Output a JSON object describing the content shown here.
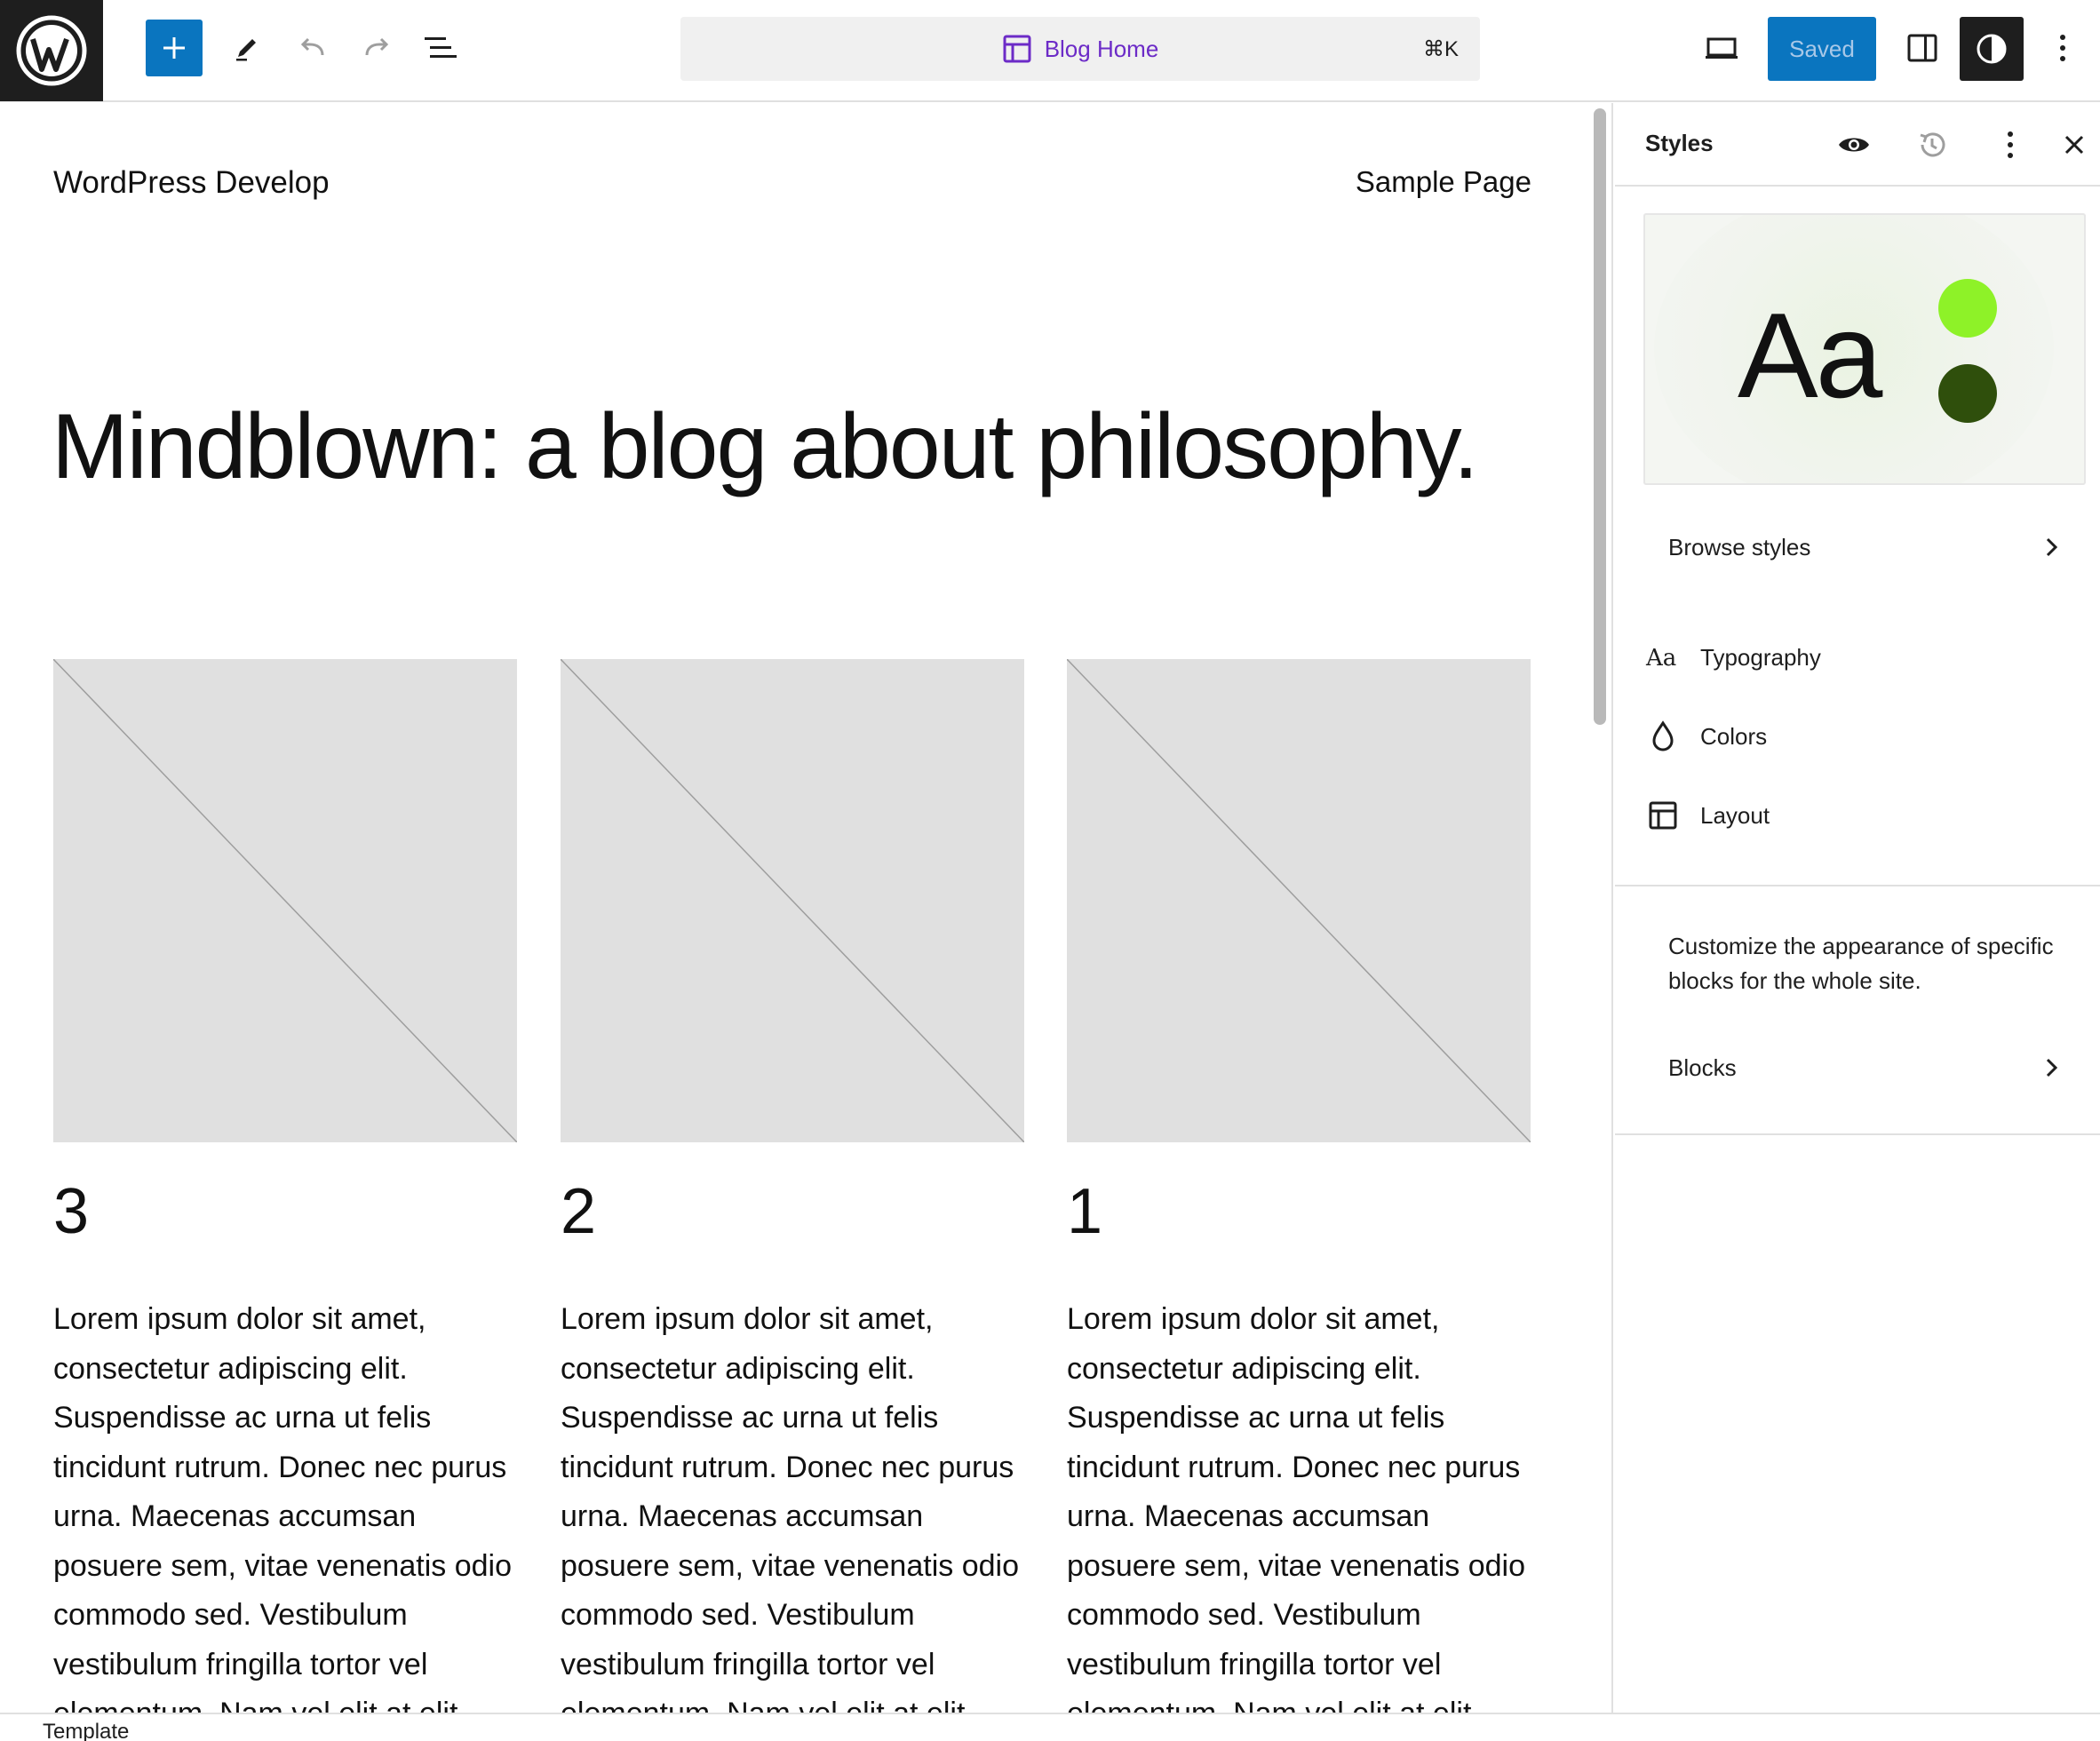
{
  "toolbar": {
    "add_block_label": "Add block",
    "command": {
      "title": "Blog Home",
      "shortcut": "⌘K"
    },
    "save_label": "Saved"
  },
  "canvas": {
    "site_title": "WordPress Develop",
    "nav": {
      "sample_page": "Sample Page"
    },
    "hero": "Mindblown: a blog about philosophy.",
    "posts": [
      {
        "title": "3",
        "excerpt": "Lorem ipsum dolor sit amet, consectetur adipiscing elit. Suspendisse ac urna ut felis tincidunt rutrum. Donec nec purus urna. Maecenas accumsan posuere sem, vitae venenatis odio commodo sed. Vestibulum vestibulum fringilla tortor vel elementum. Nam vel elit at elit"
      },
      {
        "title": "2",
        "excerpt": "Lorem ipsum dolor sit amet, consectetur adipiscing elit. Suspendisse ac urna ut felis tincidunt rutrum. Donec nec purus urna. Maecenas accumsan posuere sem, vitae venenatis odio commodo sed. Vestibulum vestibulum fringilla tortor vel elementum. Nam vel elit at elit"
      },
      {
        "title": "1",
        "excerpt": "Lorem ipsum dolor sit amet, consectetur adipiscing elit. Suspendisse ac urna ut felis tincidunt rutrum. Donec nec purus urna. Maecenas accumsan posuere sem, vitae venenatis odio commodo sed. Vestibulum vestibulum fringilla tortor vel elementum. Nam vel elit at elit"
      }
    ]
  },
  "sidebar": {
    "title": "Styles",
    "preview": {
      "sample_text": "Aa",
      "colors": [
        "#8ef228",
        "#2f4f0c"
      ]
    },
    "browse_styles": "Browse styles",
    "menu": [
      {
        "label": "Typography",
        "icon": "typography-icon"
      },
      {
        "label": "Colors",
        "icon": "droplet-icon"
      },
      {
        "label": "Layout",
        "icon": "layout-icon"
      }
    ],
    "blocks_description": "Customize the appearance of specific blocks for the whole site.",
    "blocks": "Blocks"
  },
  "footer": {
    "breadcrumb": "Template"
  },
  "colors": {
    "accent": "#0a75bf",
    "command_title": "#6c2bc7",
    "dark": "#1e1e1e",
    "placeholder": "#e0e0e0"
  }
}
